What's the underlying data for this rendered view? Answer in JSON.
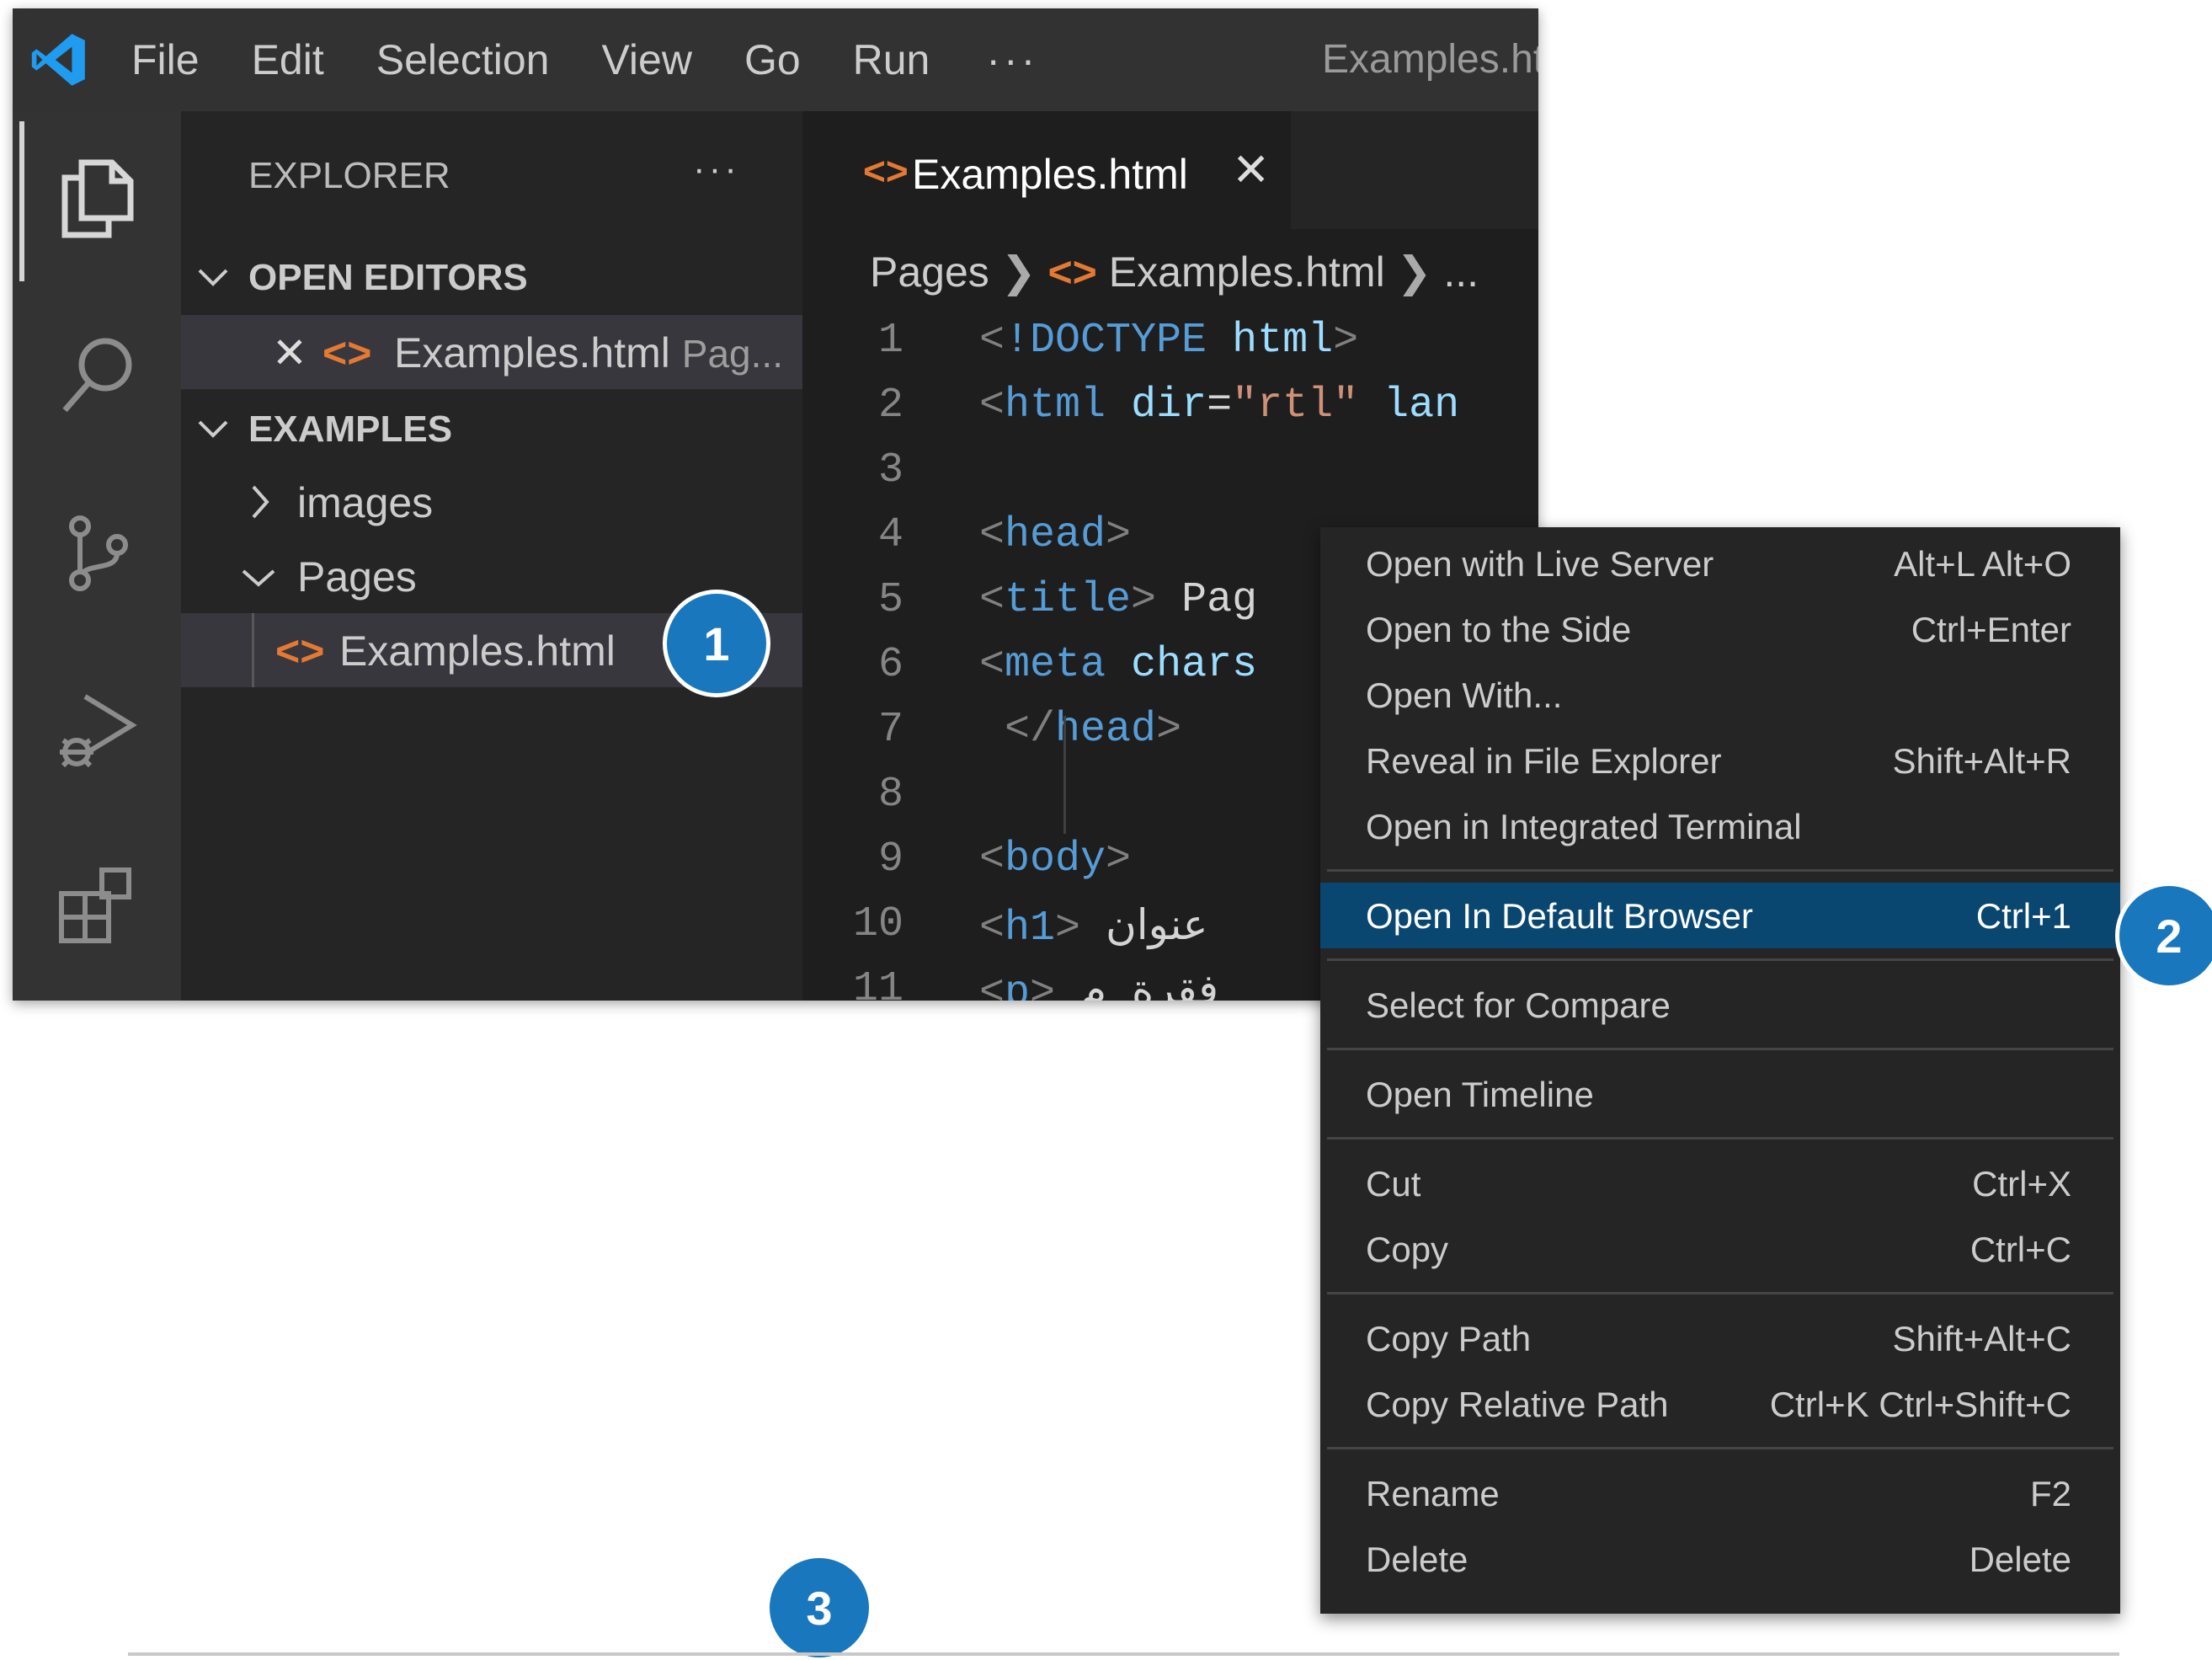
{
  "menubar": {
    "items": [
      "File",
      "Edit",
      "Selection",
      "View",
      "Go",
      "Run"
    ],
    "more": "···",
    "window_title": "Examples.ht"
  },
  "activity_bar": {
    "icons": [
      "explorer-icon",
      "search-icon",
      "source-control-icon",
      "run-debug-icon",
      "extensions-icon"
    ]
  },
  "explorer": {
    "title": "EXPLORER",
    "more": "···",
    "open_editors": {
      "label": "OPEN EDITORS",
      "file": "Examples.html",
      "desc": "Pag..."
    },
    "folder": {
      "label": "EXAMPLES",
      "items": [
        {
          "label": "images",
          "expanded": false
        },
        {
          "label": "Pages",
          "expanded": true
        }
      ],
      "selected_file": "Examples.html"
    }
  },
  "editor": {
    "tab": {
      "label": "Examples.html",
      "close": "✕"
    },
    "breadcrumb": {
      "folder": "Pages",
      "file": "Examples.html",
      "more": "..."
    },
    "lines": [
      {
        "n": "1",
        "parts": [
          [
            "br",
            "<"
          ],
          [
            "tag",
            "!DOCTYPE"
          ],
          [
            "txt",
            " "
          ],
          [
            "attr",
            "html"
          ],
          [
            "br",
            ">"
          ]
        ]
      },
      {
        "n": "2",
        "parts": [
          [
            "br",
            "<"
          ],
          [
            "tag",
            "html"
          ],
          [
            "txt",
            " "
          ],
          [
            "attr",
            "dir"
          ],
          [
            "txt",
            "="
          ],
          [
            "str",
            "\"rtl\""
          ],
          [
            "txt",
            " "
          ],
          [
            "attr",
            "lan"
          ]
        ]
      },
      {
        "n": "3",
        "parts": []
      },
      {
        "n": "4",
        "parts": [
          [
            "br",
            "<"
          ],
          [
            "tag",
            "head"
          ],
          [
            "br",
            ">"
          ]
        ]
      },
      {
        "n": "5",
        "parts": [
          [
            "br",
            "<"
          ],
          [
            "tag",
            "title"
          ],
          [
            "br",
            ">"
          ],
          [
            "txt",
            " Pag"
          ]
        ]
      },
      {
        "n": "6",
        "parts": [
          [
            "br",
            "<"
          ],
          [
            "tag",
            "meta"
          ],
          [
            "txt",
            " "
          ],
          [
            "attr",
            "chars"
          ]
        ]
      },
      {
        "n": "7",
        "parts": [
          [
            "txt",
            " "
          ],
          [
            "br",
            "</"
          ],
          [
            "tag",
            "head"
          ],
          [
            "br",
            ">"
          ]
        ]
      },
      {
        "n": "8",
        "parts": []
      },
      {
        "n": "9",
        "parts": [
          [
            "br",
            "<"
          ],
          [
            "tag",
            "body"
          ],
          [
            "br",
            ">"
          ]
        ]
      },
      {
        "n": "10",
        "parts": [
          [
            "br",
            "<"
          ],
          [
            "tag",
            "h1"
          ],
          [
            "br",
            ">"
          ],
          [
            "txt",
            " عنوان"
          ]
        ]
      },
      {
        "n": "11",
        "parts": [
          [
            "br",
            "<"
          ],
          [
            "tag",
            "p"
          ],
          [
            "br",
            ">"
          ],
          [
            "txt",
            " فقرة م"
          ]
        ]
      }
    ]
  },
  "context_menu": {
    "groups": [
      [
        {
          "label": "Open with Live Server",
          "key": "Alt+L Alt+O"
        },
        {
          "label": "Open to the Side",
          "key": "Ctrl+Enter"
        },
        {
          "label": "Open With...",
          "key": ""
        },
        {
          "label": "Reveal in File Explorer",
          "key": "Shift+Alt+R"
        },
        {
          "label": "Open in Integrated Terminal",
          "key": ""
        }
      ],
      [
        {
          "label": "Open In Default Browser",
          "key": "Ctrl+1",
          "active": true
        }
      ],
      [
        {
          "label": "Select for Compare",
          "key": ""
        }
      ],
      [
        {
          "label": "Open Timeline",
          "key": ""
        }
      ],
      [
        {
          "label": "Cut",
          "key": "Ctrl+X"
        },
        {
          "label": "Copy",
          "key": "Ctrl+C"
        }
      ],
      [
        {
          "label": "Copy Path",
          "key": "Shift+Alt+C"
        },
        {
          "label": "Copy Relative Path",
          "key": "Ctrl+K Ctrl+Shift+C"
        }
      ],
      [
        {
          "label": "Rename",
          "key": "F2"
        },
        {
          "label": "Delete",
          "key": "Delete"
        }
      ]
    ]
  },
  "callouts": [
    "1",
    "2",
    "3"
  ],
  "colors": {
    "accent": "#1877bd",
    "selection": "#094771",
    "html_icon": "#e37933"
  }
}
